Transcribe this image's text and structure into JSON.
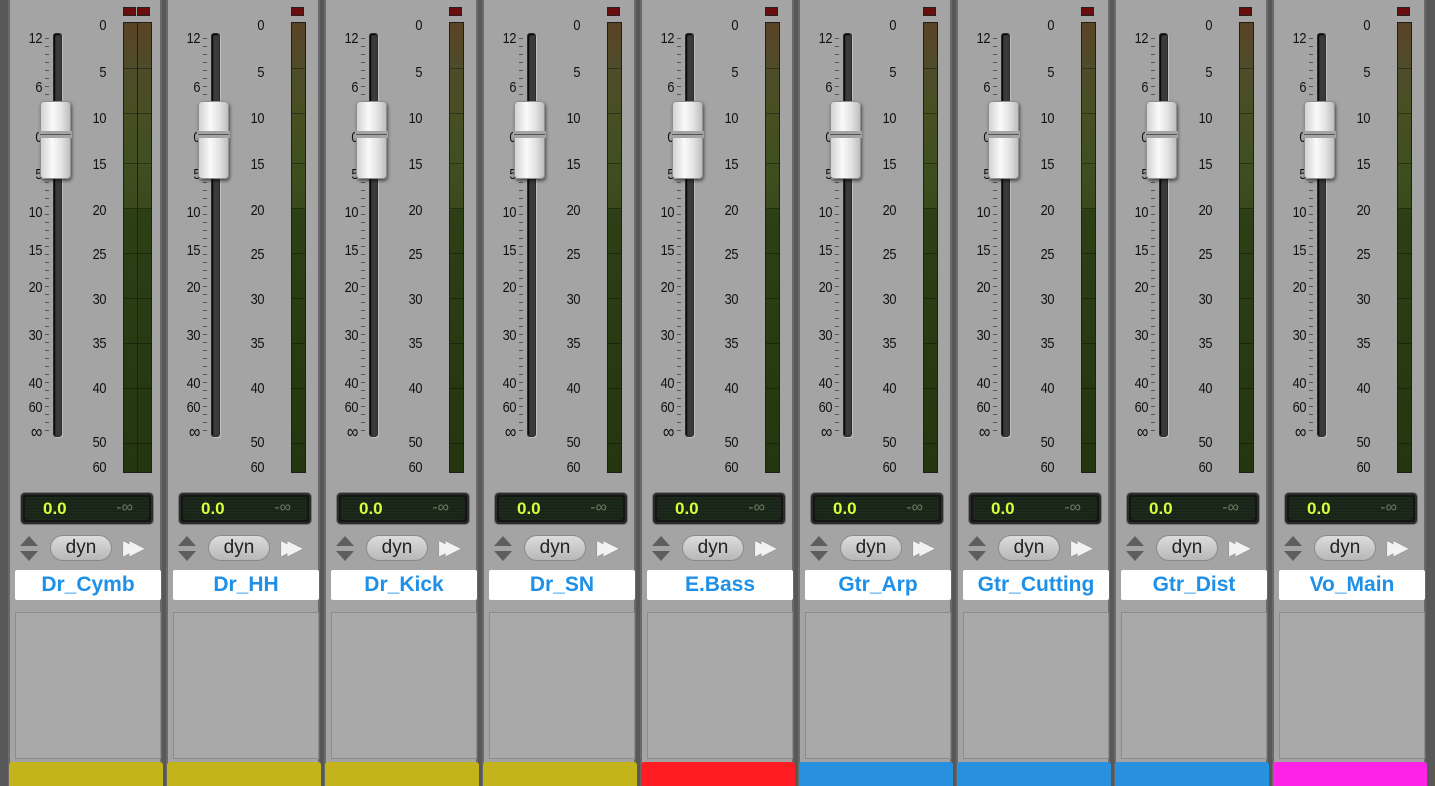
{
  "fader_scale_labels": [
    "12",
    "6",
    "0",
    "5",
    "10",
    "15",
    "20",
    "30",
    "40",
    "60",
    "∞"
  ],
  "meter_scale_labels": [
    "0",
    "5",
    "10",
    "15",
    "20",
    "25",
    "30",
    "35",
    "40",
    "50",
    "60"
  ],
  "tracks": [
    {
      "name": "Dr_Cymb",
      "volume": "0.0",
      "peak": "-∞",
      "automation": "dyn",
      "color": "#c2b41a"
    },
    {
      "name": "Dr_HH",
      "volume": "0.0",
      "peak": "-∞",
      "automation": "dyn",
      "color": "#c2b41a"
    },
    {
      "name": "Dr_Kick",
      "volume": "0.0",
      "peak": "-∞",
      "automation": "dyn",
      "color": "#c2b41a"
    },
    {
      "name": "Dr_SN",
      "volume": "0.0",
      "peak": "-∞",
      "automation": "dyn",
      "color": "#c2b41a"
    },
    {
      "name": "E.Bass",
      "volume": "0.0",
      "peak": "-∞",
      "automation": "dyn",
      "color": "#ff1d23"
    },
    {
      "name": "Gtr_Arp",
      "volume": "0.0",
      "peak": "-∞",
      "automation": "dyn",
      "color": "#2790df"
    },
    {
      "name": "Gtr_Cutting",
      "volume": "0.0",
      "peak": "-∞",
      "automation": "dyn",
      "color": "#2790df"
    },
    {
      "name": "Gtr_Dist",
      "volume": "0.0",
      "peak": "-∞",
      "automation": "dyn",
      "color": "#2790df"
    },
    {
      "name": "Vo_Main",
      "volume": "0.0",
      "peak": "-∞",
      "automation": "dyn",
      "color": "#ff22e6"
    }
  ]
}
